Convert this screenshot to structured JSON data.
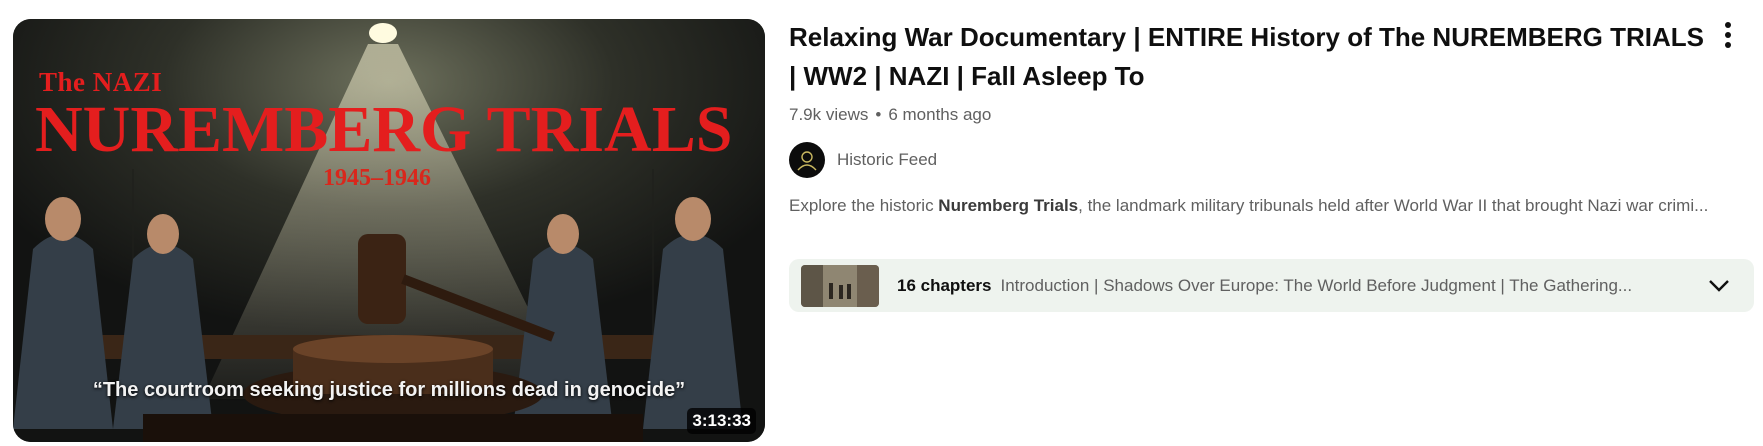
{
  "video": {
    "thumbnail": {
      "small_title": "The NAZI",
      "big_title": "NUREMBERG TRIALS",
      "years": "1945–1946",
      "quote": "“The courtroom seeking justice for millions dead in genocide”",
      "duration": "3:13:33",
      "title_color": "#e41e1e"
    },
    "title": "Relaxing War Documentary | ENTIRE History of The NUREMBERG TRIALS | WW2 | NAZI | Fall Asleep To",
    "views": "7.9k views",
    "separator": "•",
    "age": "6 months ago",
    "channel": {
      "name": "Historic Feed",
      "avatar_icon": "person-icon"
    },
    "description": {
      "prefix": "Explore the historic ",
      "bold": "Nuremberg Trials",
      "suffix": ", the landmark military tribunals held after World War II that brought Nazi war crimi..."
    },
    "chapters": {
      "count_label": "16 chapters",
      "list": "Introduction | Shadows Over Europe: The World Before Judgment | The Gathering...",
      "expand_icon": "chevron-down-icon"
    },
    "menu_icon": "more-vertical-icon"
  }
}
